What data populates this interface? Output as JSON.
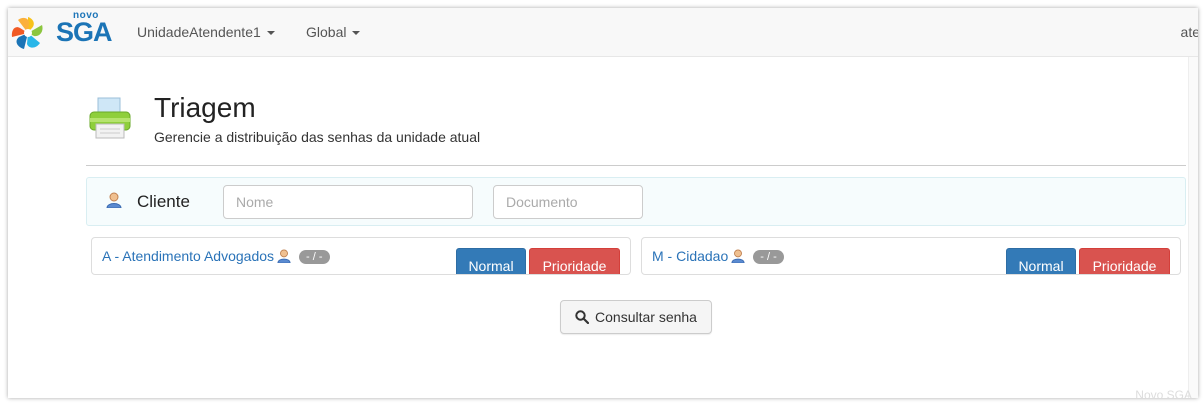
{
  "brand": {
    "small": "novo",
    "name": "SGA"
  },
  "nav": {
    "items": [
      {
        "label": "UnidadeAtendente1"
      },
      {
        "label": "Global"
      }
    ],
    "user": "ate"
  },
  "page": {
    "title": "Triagem",
    "subtitle": "Gerencie a distribuição das senhas da unidade atual"
  },
  "client": {
    "label": "Cliente",
    "name_placeholder": "Nome",
    "document_placeholder": "Documento"
  },
  "services": [
    {
      "name": "A - Atendimento Advogados",
      "badge": "- / -",
      "normal_label": "Normal",
      "priority_label": "Prioridade"
    },
    {
      "name": "M - Cidadao",
      "badge": "- / -",
      "normal_label": "Normal",
      "priority_label": "Prioridade"
    }
  ],
  "actions": {
    "consult_label": "Consultar senha"
  },
  "footer": {
    "text": "Novo SGA"
  },
  "colors": {
    "primary": "#337ab7",
    "danger": "#d9534f",
    "link": "#2a73b8",
    "brand": "#1b74b6"
  }
}
